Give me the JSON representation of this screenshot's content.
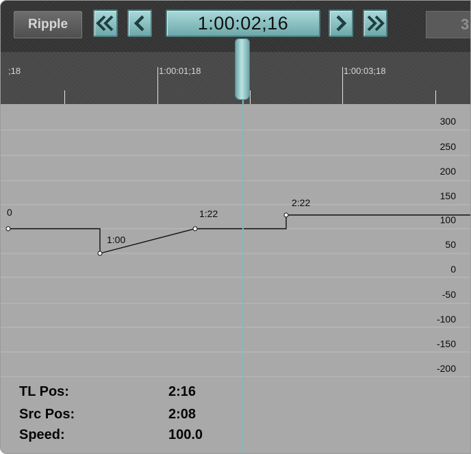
{
  "toolbar": {
    "ripple_label": "Ripple",
    "timecode": "1:00:02;16",
    "right_timecode_partial": "3:",
    "rewind_icon": "double-chevron-left-icon",
    "prev_icon": "chevron-left-icon",
    "next_icon": "chevron-right-icon",
    "fastforward_icon": "double-chevron-right-icon"
  },
  "ruler": {
    "labels": [
      ";18",
      "1:00:01;18",
      "1:00:03;18"
    ]
  },
  "graph": {
    "y_ticks": [
      "300",
      "250",
      "200",
      "150",
      "100",
      "50",
      "0",
      "-50",
      "-100",
      "-150",
      "-200"
    ],
    "keyframe_labels": [
      "0",
      "1:00",
      "1:22",
      "2:22"
    ]
  },
  "info": {
    "tl_pos_label": "TL Pos:",
    "tl_pos_value": "2:16",
    "src_pos_label": "Src Pos:",
    "src_pos_value": "2:08",
    "speed_label": "Speed:",
    "speed_value": "100.0"
  },
  "colors": {
    "accent_teal": "#8cc8ca",
    "toolbar_bg": "#363636",
    "graph_bg": "#a9a9a9"
  }
}
